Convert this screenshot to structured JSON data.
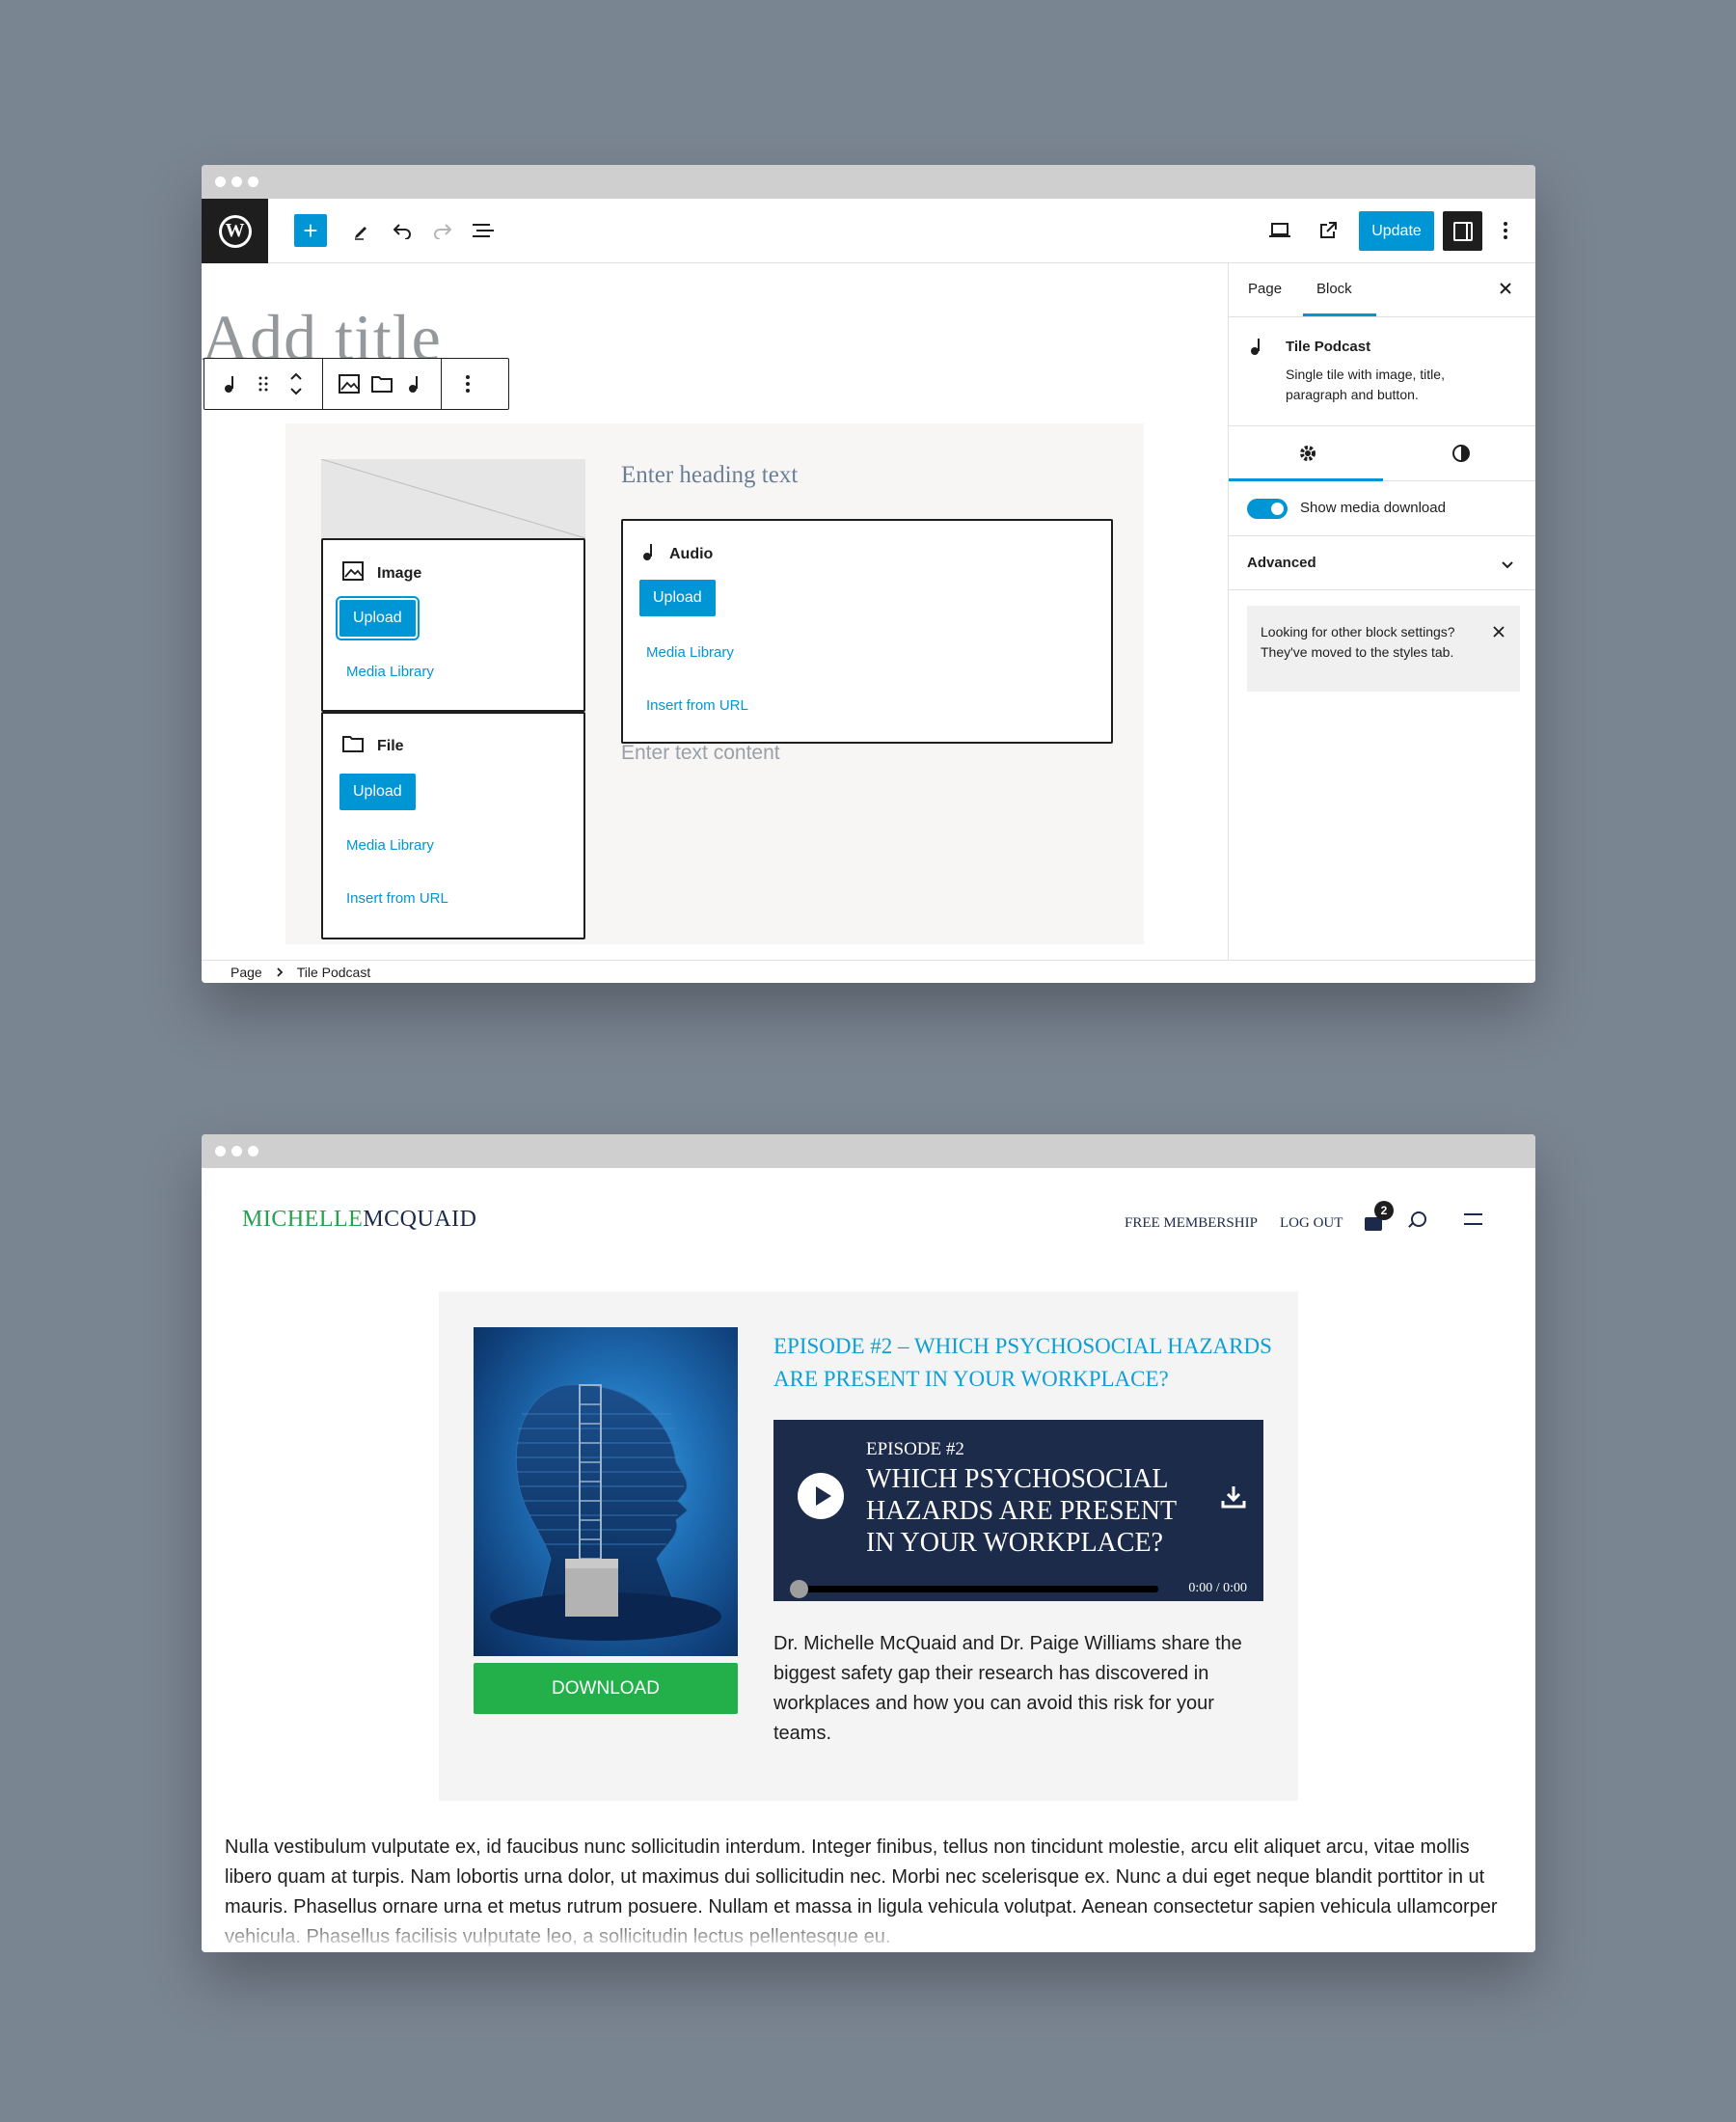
{
  "editor": {
    "toolbar": {
      "plus": "+",
      "update_label": "Update",
      "icons": [
        "wordpress-logo",
        "pencil-icon",
        "undo-icon",
        "redo-icon",
        "list-view-icon",
        "desktop-preview-icon",
        "external-link-icon",
        "sidebar-toggle-icon",
        "more-options-icon"
      ]
    },
    "title_placeholder": "Add title",
    "block_toolbar": {
      "icons": [
        "music-note-icon",
        "drag-handle-icon",
        "move-arrows-icon",
        "image-icon",
        "folder-icon",
        "music-note-icon",
        "more-options-icon"
      ]
    },
    "tile": {
      "image_box": {
        "title": "Image",
        "upload": "Upload",
        "media_library": "Media Library"
      },
      "file_box": {
        "title": "File",
        "upload": "Upload",
        "media_library": "Media Library",
        "insert_url": "Insert from URL"
      },
      "heading_placeholder": "Enter heading text",
      "audio_box": {
        "title": "Audio",
        "upload": "Upload",
        "media_library": "Media Library",
        "insert_url": "Insert from URL"
      },
      "text_placeholder": "Enter text content"
    },
    "sidebar": {
      "tabs": [
        "Page",
        "Block"
      ],
      "block_name": "Tile Podcast",
      "block_description": "Single tile with image, title, paragraph and button.",
      "toggle_label": "Show media download",
      "toggle_on": true,
      "advanced_label": "Advanced",
      "notice": "Looking for other block settings? They've moved to the styles tab."
    },
    "breadcrumbs": [
      "Page",
      "Tile Podcast"
    ],
    "accent_color": "#0095d5"
  },
  "site": {
    "logo_part1": "michelle",
    "logo_part2": "mcquaid",
    "nav": [
      "FREE MEMBERSHIP",
      "LOG OUT"
    ],
    "cart_count": "2",
    "episode": {
      "title": "EPISODE #2 – WHICH PSYCHOSOCIAL HAZARDS ARE PRESENT IN YOUR WORKPLACE?",
      "download_label": "DOWNLOAD",
      "player_episode": "EPISODE #2",
      "player_title": "WHICH PSYCHOSOCIAL HAZARDS ARE PRESENT IN YOUR WORKPLACE?",
      "player_time": "0:00 / 0:00",
      "description": "Dr. Michelle McQuaid and Dr. Paige Williams share the biggest safety gap their research has discovered in workplaces and how you can avoid this risk for your teams."
    },
    "body_text": "Nulla vestibulum vulputate ex, id faucibus nunc sollicitudin interdum. Integer finibus, tellus non tincidunt molestie, arcu elit aliquet arcu, vitae mollis libero quam at turpis. Nam lobortis urna dolor, ut maximus dui sollicitudin nec. Morbi nec scelerisque ex. Nunc a dui eget neque blandit porttitor in ut mauris. Phasellus ornare urna et metus rutrum posuere. Nullam et massa in ligula vehicula volutpat. Aenean consectetur sapien vehicula ullamcorper vehicula. Phasellus facilisis vulputate leo, a sollicitudin lectus pellentesque eu.",
    "brand_green": "#23a24d",
    "brand_navy": "#1b2a4a",
    "title_blue": "#0d9fd6"
  }
}
